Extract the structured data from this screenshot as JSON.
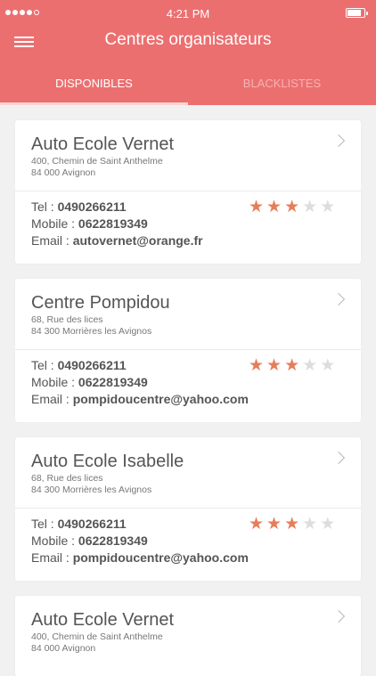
{
  "statusbar": {
    "time": "4:21 PM"
  },
  "header": {
    "title": "Centres organisateurs"
  },
  "tabs": {
    "active": "DISPONIBLES",
    "inactive": "BLACKLISTES"
  },
  "colors": {
    "header": "#ec6f70",
    "star_on": "#e67e5a",
    "star_off": "#dddddd"
  },
  "centers": [
    {
      "name": "Auto Ecole Vernet",
      "address_line1": "400, Chemin de Saint Anthelme",
      "address_line2": "84 000 Avignon",
      "tel_label": "Tel : ",
      "tel": "0490266211",
      "mobile_label": "Mobile : ",
      "mobile": "0622819349",
      "email_label": "Email : ",
      "email": "autovernet@orange.fr",
      "rating": 3,
      "rating_max": 5
    },
    {
      "name": "Centre Pompidou",
      "address_line1": "68, Rue des lices",
      "address_line2": "84 300 Morrières les Avignos",
      "tel_label": "Tel : ",
      "tel": "0490266211",
      "mobile_label": "Mobile : ",
      "mobile": "0622819349",
      "email_label": "Email : ",
      "email": "pompidoucentre@yahoo.com",
      "rating": 3,
      "rating_max": 5
    },
    {
      "name": "Auto Ecole Isabelle",
      "address_line1": "68, Rue des lices",
      "address_line2": "84 300 Morrières les Avignos",
      "tel_label": "Tel : ",
      "tel": "0490266211",
      "mobile_label": "Mobile : ",
      "mobile": "0622819349",
      "email_label": "Email : ",
      "email": "pompidoucentre@yahoo.com",
      "rating": 3,
      "rating_max": 5
    },
    {
      "name": "Auto Ecole Vernet",
      "address_line1": "400, Chemin de Saint Anthelme",
      "address_line2": "84 000 Avignon"
    }
  ]
}
